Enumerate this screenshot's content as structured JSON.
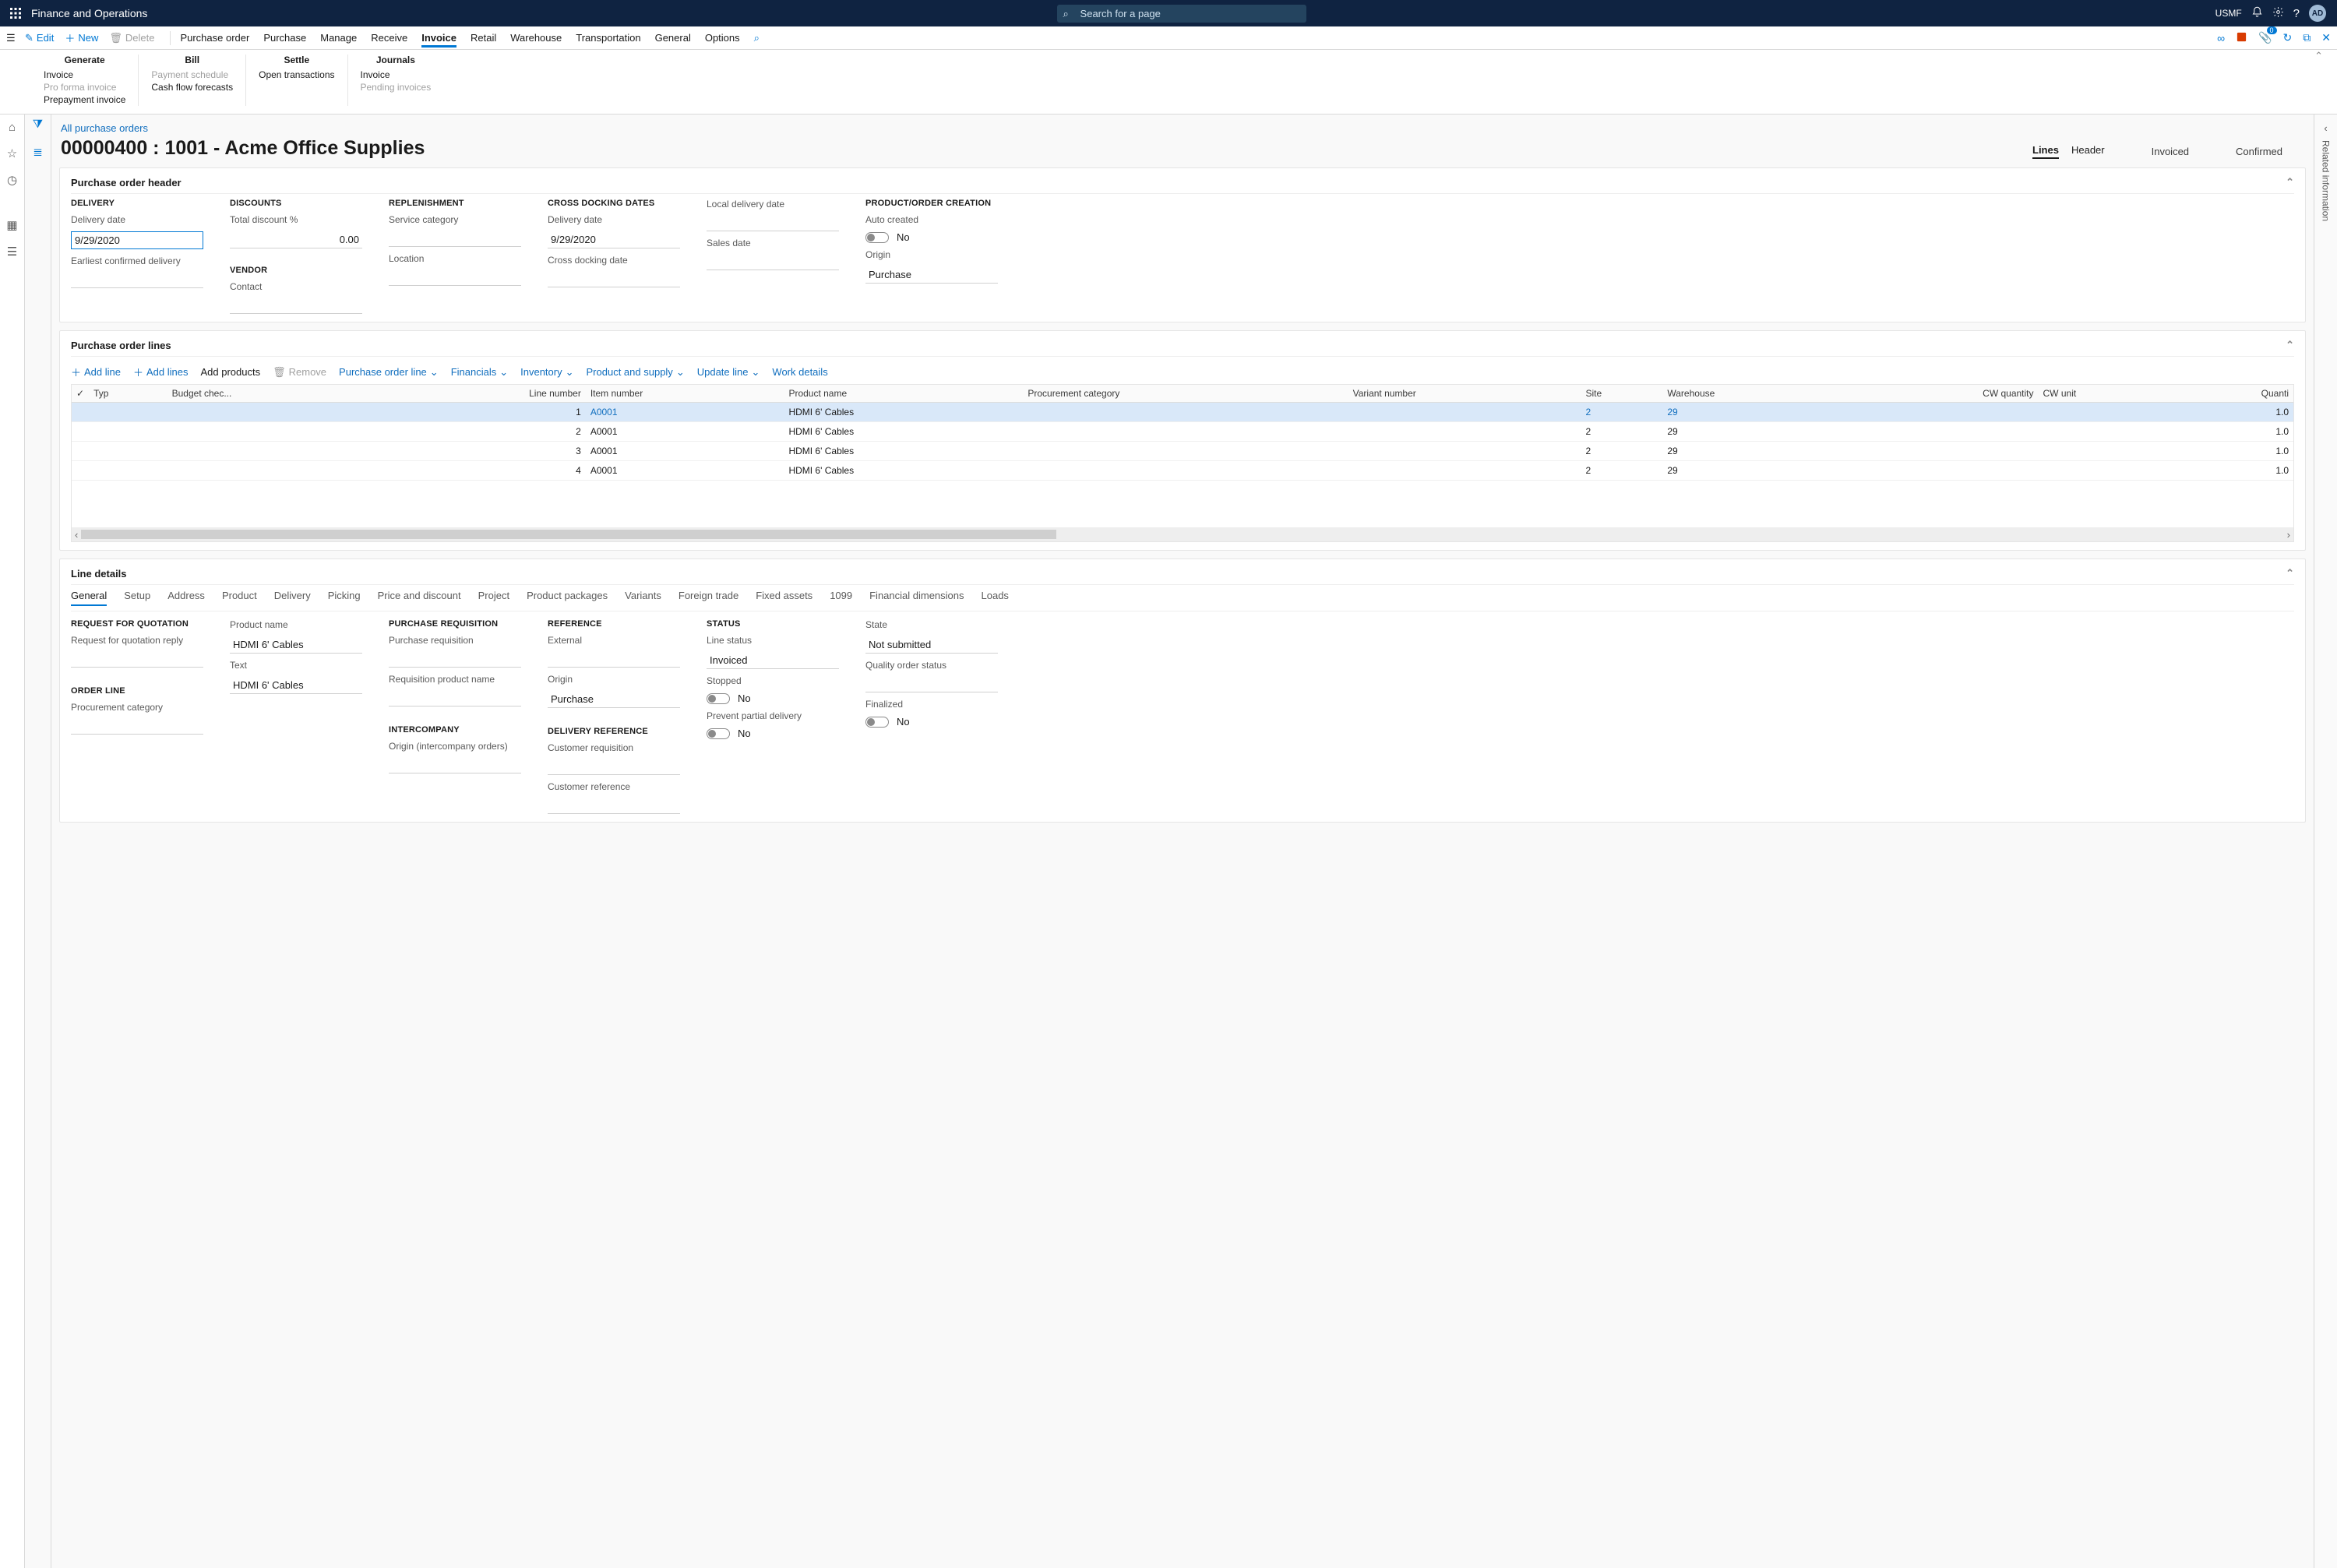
{
  "app_title": "Finance and Operations",
  "company": "USMF",
  "avatar": "AD",
  "search_placeholder": "Search for a page",
  "cmd": {
    "edit": "Edit",
    "new": "New",
    "delete": "Delete"
  },
  "tabs": [
    "Purchase order",
    "Purchase",
    "Manage",
    "Receive",
    "Invoice",
    "Retail",
    "Warehouse",
    "Transportation",
    "General",
    "Options"
  ],
  "active_tab": "Invoice",
  "ribbon": {
    "generate": {
      "title": "Generate",
      "items": [
        "Invoice",
        "Pro forma invoice",
        "Prepayment invoice"
      ]
    },
    "bill": {
      "title": "Bill",
      "items": [
        "Payment schedule",
        "Cash flow forecasts"
      ]
    },
    "settle": {
      "title": "Settle",
      "items": [
        "Open transactions"
      ]
    },
    "journals": {
      "title": "Journals",
      "items": [
        "Invoice",
        "Pending invoices"
      ]
    }
  },
  "crumb": "All purchase orders",
  "page_title": "00000400 : 1001 - Acme Office Supplies",
  "subtabs": {
    "lines": "Lines",
    "header": "Header"
  },
  "status1": "Invoiced",
  "status2": "Confirmed",
  "header_card": {
    "title": "Purchase order header",
    "delivery": {
      "section": "DELIVERY",
      "date_label": "Delivery date",
      "date": "9/29/2020",
      "earliest_label": "Earliest confirmed delivery"
    },
    "discounts": {
      "section": "DISCOUNTS",
      "pct_label": "Total discount %",
      "pct": "0.00"
    },
    "vendor": {
      "section": "VENDOR",
      "contact_label": "Contact"
    },
    "replenishment": {
      "section": "REPLENISHMENT",
      "svc_label": "Service category",
      "loc_label": "Location"
    },
    "cross": {
      "section": "CROSS DOCKING DATES",
      "del_label": "Delivery date",
      "del": "9/29/2020",
      "cdd_label": "Cross docking date"
    },
    "local": {
      "local_label": "Local delivery date",
      "sales_label": "Sales date"
    },
    "product": {
      "section": "PRODUCT/ORDER CREATION",
      "auto_label": "Auto created",
      "no": "No",
      "origin_label": "Origin",
      "origin": "Purchase"
    }
  },
  "lines_card": {
    "title": "Purchase order lines",
    "actions": {
      "add_line": "Add line",
      "add_lines": "Add lines",
      "add_products": "Add products",
      "remove": "Remove",
      "po_line": "Purchase order line",
      "financials": "Financials",
      "inventory": "Inventory",
      "product_supply": "Product and supply",
      "update": "Update line",
      "work": "Work details"
    },
    "columns": [
      "Typ",
      "Budget chec...",
      "Line number",
      "Item number",
      "Product name",
      "Procurement category",
      "Variant number",
      "Site",
      "Warehouse",
      "CW quantity",
      "CW unit",
      "Quanti"
    ],
    "rows": [
      {
        "ln": "1",
        "item": "A0001",
        "name": "HDMI 6' Cables",
        "site": "2",
        "wh": "29",
        "qty": "1.0"
      },
      {
        "ln": "2",
        "item": "A0001",
        "name": "HDMI 6' Cables",
        "site": "2",
        "wh": "29",
        "qty": "1.0"
      },
      {
        "ln": "3",
        "item": "A0001",
        "name": "HDMI 6' Cables",
        "site": "2",
        "wh": "29",
        "qty": "1.0"
      },
      {
        "ln": "4",
        "item": "A0001",
        "name": "HDMI 6' Cables",
        "site": "2",
        "wh": "29",
        "qty": "1.0"
      }
    ]
  },
  "line_details": {
    "title": "Line details",
    "tabs": [
      "General",
      "Setup",
      "Address",
      "Product",
      "Delivery",
      "Picking",
      "Price and discount",
      "Project",
      "Product packages",
      "Variants",
      "Foreign trade",
      "Fixed assets",
      "1099",
      "Financial dimensions",
      "Loads"
    ],
    "rfq": {
      "section": "REQUEST FOR QUOTATION",
      "reply_label": "Request for quotation reply"
    },
    "orderline": {
      "section": "ORDER LINE",
      "proc_label": "Procurement category"
    },
    "product": {
      "name_label": "Product name",
      "name": "HDMI 6' Cables",
      "text_label": "Text",
      "text": "HDMI 6' Cables"
    },
    "pr": {
      "section": "PURCHASE REQUISITION",
      "pr_label": "Purchase requisition",
      "rpn_label": "Requisition product name"
    },
    "ic": {
      "section": "INTERCOMPANY",
      "origin_label": "Origin (intercompany orders)"
    },
    "ref": {
      "section": "REFERENCE",
      "external_label": "External",
      "origin_label": "Origin",
      "origin": "Purchase"
    },
    "delref": {
      "section": "DELIVERY REFERENCE",
      "cr_label": "Customer requisition",
      "custref_label": "Customer reference"
    },
    "status": {
      "section": "STATUS",
      "ls_label": "Line status",
      "ls": "Invoiced",
      "stopped_label": "Stopped",
      "stopped": "No",
      "ppd_label": "Prevent partial delivery",
      "ppd": "No"
    },
    "state": {
      "state_label": "State",
      "state": "Not submitted",
      "qos_label": "Quality order status",
      "fin_label": "Finalized",
      "fin": "No"
    }
  },
  "related_info": "Related information"
}
